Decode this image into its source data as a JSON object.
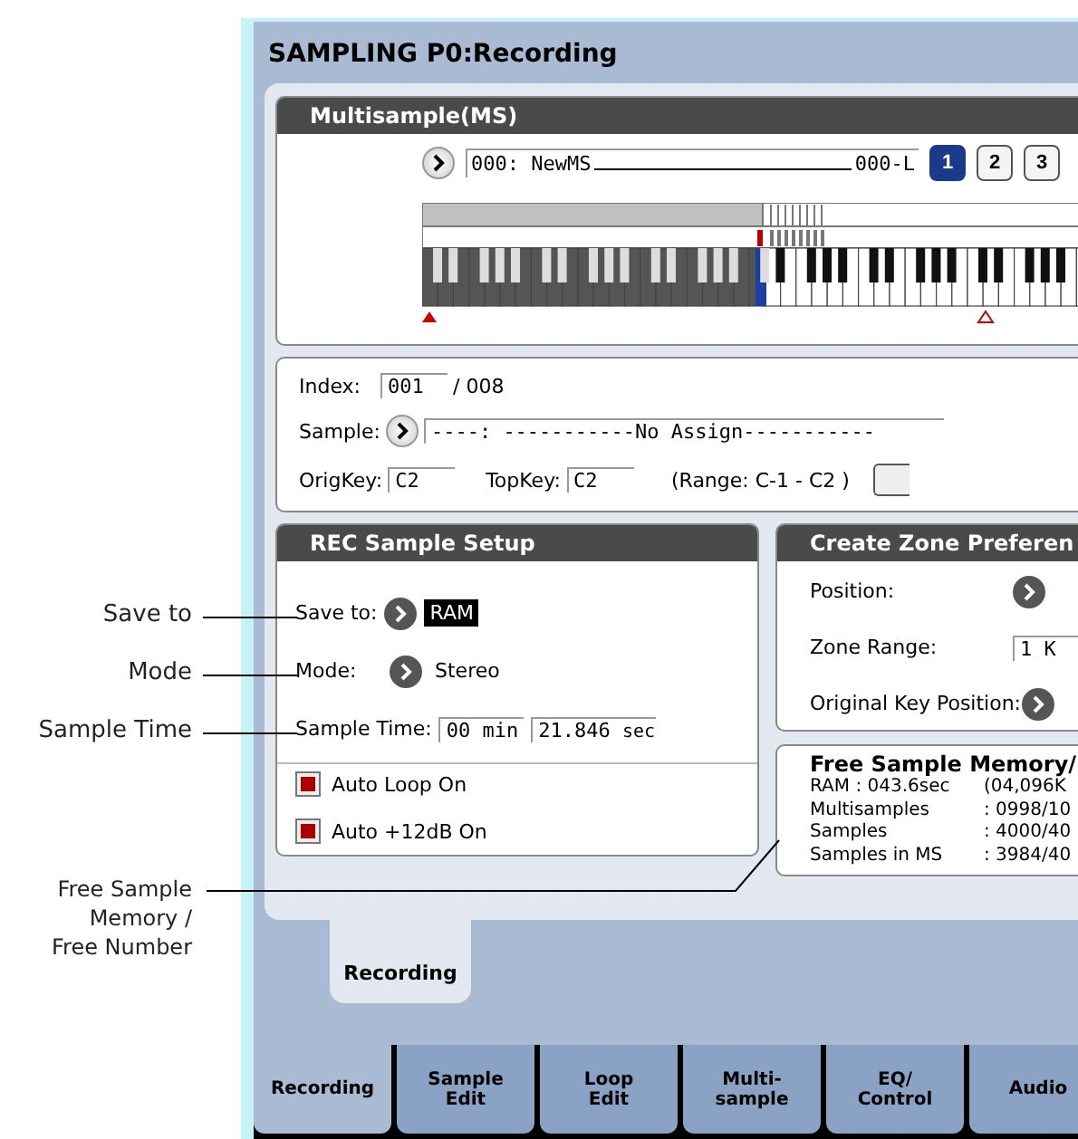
{
  "callouts": [
    {
      "label": "Save to"
    },
    {
      "label": "Mode"
    },
    {
      "label": "Sample Time"
    },
    {
      "label": "Free Sample Memory / Free Number"
    }
  ],
  "window": {
    "title": "SAMPLING P0:Recording"
  },
  "multisample": {
    "header": "Multisample(MS)",
    "name": "000: NewMS",
    "suffix": "000-L",
    "banks": [
      {
        "label": "1",
        "selected": true
      },
      {
        "label": "2",
        "selected": false
      },
      {
        "label": "3",
        "selected": false
      }
    ]
  },
  "zone": {
    "index_label": "Index:",
    "index": "001",
    "index_total": "/ 008",
    "sample_label": "Sample:",
    "sample": "----: -----------No Assign-----------",
    "origkey_label": "OrigKey:",
    "origkey": "C2",
    "topkey_label": "TopKey:",
    "topkey": "C2",
    "range": "(Range: C-1  - C2   )"
  },
  "rec_setup": {
    "header": "REC Sample Setup",
    "save_to_label": "Save to:",
    "save_to": {
      "value": "RAM",
      "selected": true
    },
    "mode_label": "Mode:",
    "mode": "Stereo",
    "time_label": "Sample Time:",
    "time_min": "00 min",
    "time_sec": "21.846",
    "sec_unit": "sec",
    "options": [
      {
        "label": "Auto Loop On",
        "checked": true
      },
      {
        "label": "Auto +12dB On",
        "checked": true
      }
    ]
  },
  "create_zone": {
    "header": "Create Zone Preferen",
    "rows": [
      {
        "label": "Position:",
        "kind": "popup"
      },
      {
        "label": "Zone Range:",
        "kind": "field",
        "value": "1 K"
      },
      {
        "label": "Original Key Position:",
        "kind": "popup"
      }
    ]
  },
  "free_memory": {
    "title": "Free Sample Memory/",
    "lines": [
      {
        "label": "RAM : 043.6sec",
        "value": "(04,096K"
      },
      {
        "label": "Multisamples",
        "value": ": 0998/10"
      },
      {
        "label": "Samples",
        "value": ": 4000/40"
      },
      {
        "label": "Samples in MS",
        "value": ": 3984/40"
      }
    ]
  },
  "page_tab": {
    "label": "Recording"
  },
  "tabs": [
    {
      "label": "Recording",
      "selected": true
    },
    {
      "label": "Sample Edit",
      "selected": false
    },
    {
      "label": "Loop Edit",
      "selected": false
    },
    {
      "label": "Multi-sample",
      "selected": false
    },
    {
      "label": "EQ/ Control",
      "selected": false
    },
    {
      "label": "Audio",
      "selected": false
    }
  ]
}
